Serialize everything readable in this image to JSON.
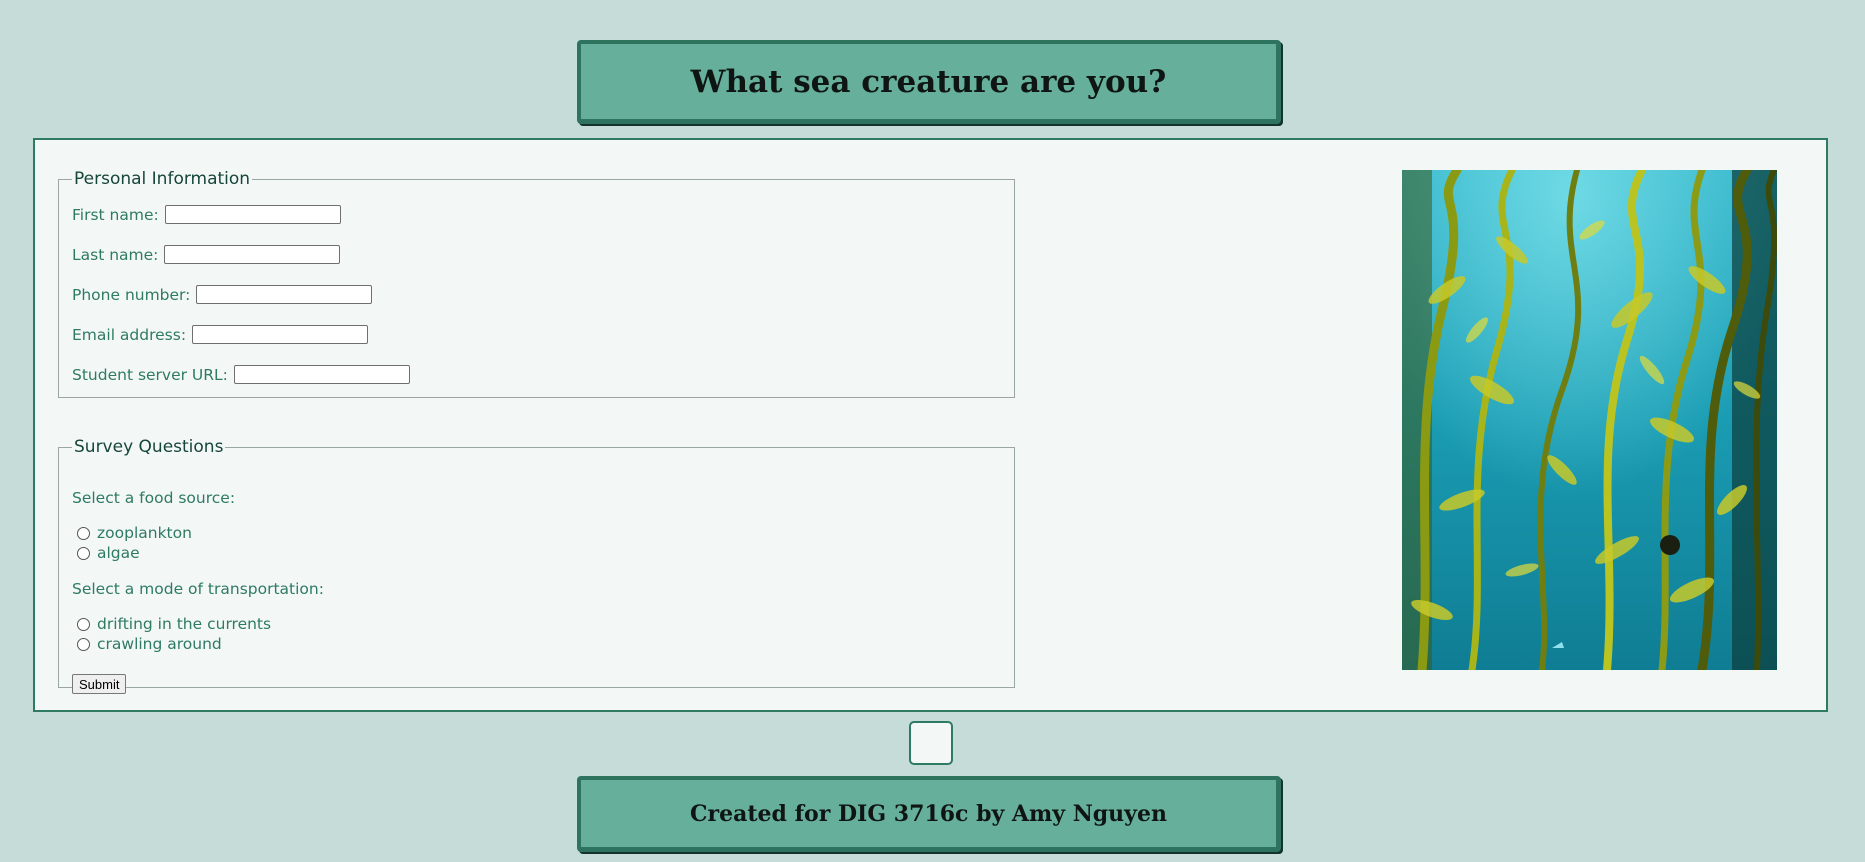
{
  "header": {
    "title": "What sea creature are you?"
  },
  "personal": {
    "legend": "Personal Information",
    "fields": [
      {
        "label": "First name:",
        "value": ""
      },
      {
        "label": "Last name:",
        "value": ""
      },
      {
        "label": "Phone number:",
        "value": ""
      },
      {
        "label": "Email address:",
        "value": ""
      },
      {
        "label": "Student server URL:",
        "value": ""
      }
    ]
  },
  "survey": {
    "legend": "Survey Questions",
    "questions": [
      {
        "prompt": "Select a food source:",
        "options": [
          "zooplankton",
          "algae"
        ]
      },
      {
        "prompt": "Select a mode of transportation:",
        "options": [
          "drifting in the currents",
          "crawling around"
        ]
      }
    ],
    "submit_label": "Submit"
  },
  "image": {
    "subject": "kelp-forest-photo"
  },
  "footer": {
    "credit": "Created for DIG 3716c by Amy Nguyen"
  },
  "colors": {
    "page_background": "#c5dcd9",
    "banner_fill": "#66b09b",
    "banner_border": "#2d735d",
    "panel_background": "#f3f8f7",
    "label_text": "#2f7a63",
    "legend_text": "#16453a"
  }
}
